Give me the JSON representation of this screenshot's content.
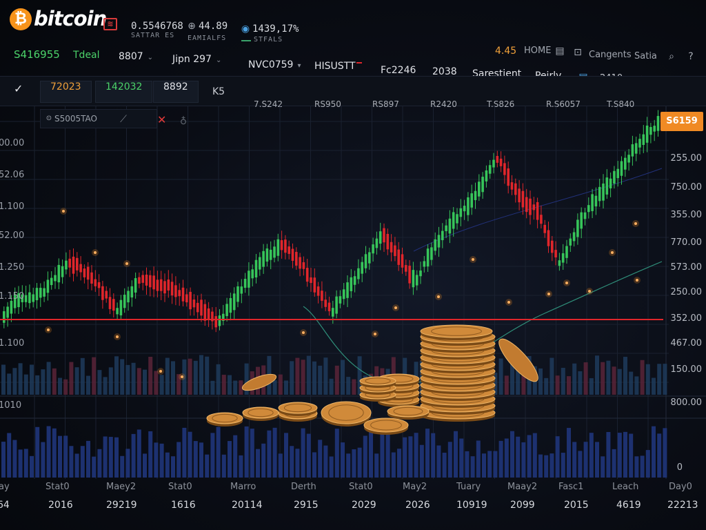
{
  "brand": {
    "name": "bitcoin",
    "symbol": "₿"
  },
  "header": {
    "tickers": [
      {
        "value": "0.5546768",
        "sub": "SATTAR ES"
      },
      {
        "value": "44.89",
        "sub": "EAMIALFS"
      },
      {
        "value": "1439,17%",
        "sub": "STFALS"
      }
    ],
    "row2": {
      "price": "S416955",
      "items": [
        {
          "label": "Tdeal",
          "caret": false
        },
        {
          "label": "8807",
          "caret": true
        },
        {
          "label": "Jipn 297",
          "caret": true
        },
        {
          "label": "NVC0759",
          "caret": true
        },
        {
          "label": "HISUSTT",
          "caret": false
        }
      ]
    },
    "right_top": {
      "value": "4.45",
      "home": "HOME",
      "link1": "Cangents",
      "link2": "Satia"
    },
    "row3": {
      "items": [
        "Fc2246",
        "2038",
        "Sarestient",
        "Peirly"
      ],
      "value": "2410"
    }
  },
  "tabs": {
    "items": [
      "72023",
      "142032",
      "8892",
      "K5"
    ],
    "columns": [
      "7.S242",
      "RS950",
      "RS897",
      "R2420",
      "T.S826",
      "R.S6057",
      "T.S840"
    ]
  },
  "chart_toolbar": {
    "label": "S5005TAO"
  },
  "price_tag": "S6159",
  "chart_data": {
    "type": "candlestick",
    "y_axis_right": [
      "255.00",
      "750.00",
      "355.00",
      "770.00",
      "573.00",
      "250.00",
      "352.00",
      "467.00",
      "150.00",
      "800.00",
      "0"
    ],
    "y_axis_left": [
      "00.00",
      "52.06",
      "1.100",
      "52.00",
      "1.250",
      "1.150",
      "1.100",
      "1010"
    ],
    "x_labels_top": [
      "ay",
      "Stat0",
      "Maey2",
      "Stat0",
      "Marro",
      "Derth",
      "Stat0",
      "May2",
      "Tuary",
      "Maay2",
      "Fasc1",
      "Leach",
      "Day0"
    ],
    "x_labels_bottom": [
      "64",
      "2016",
      "29219",
      "1616",
      "20114",
      "2915",
      "2029",
      "2026",
      "10919",
      "2099",
      "2015",
      "4619",
      "22213"
    ],
    "support_line": "352.00",
    "colors": {
      "up": "#37c55a",
      "down": "#e0262b",
      "support": "#e0262b",
      "volume": "#2a3f78"
    }
  }
}
